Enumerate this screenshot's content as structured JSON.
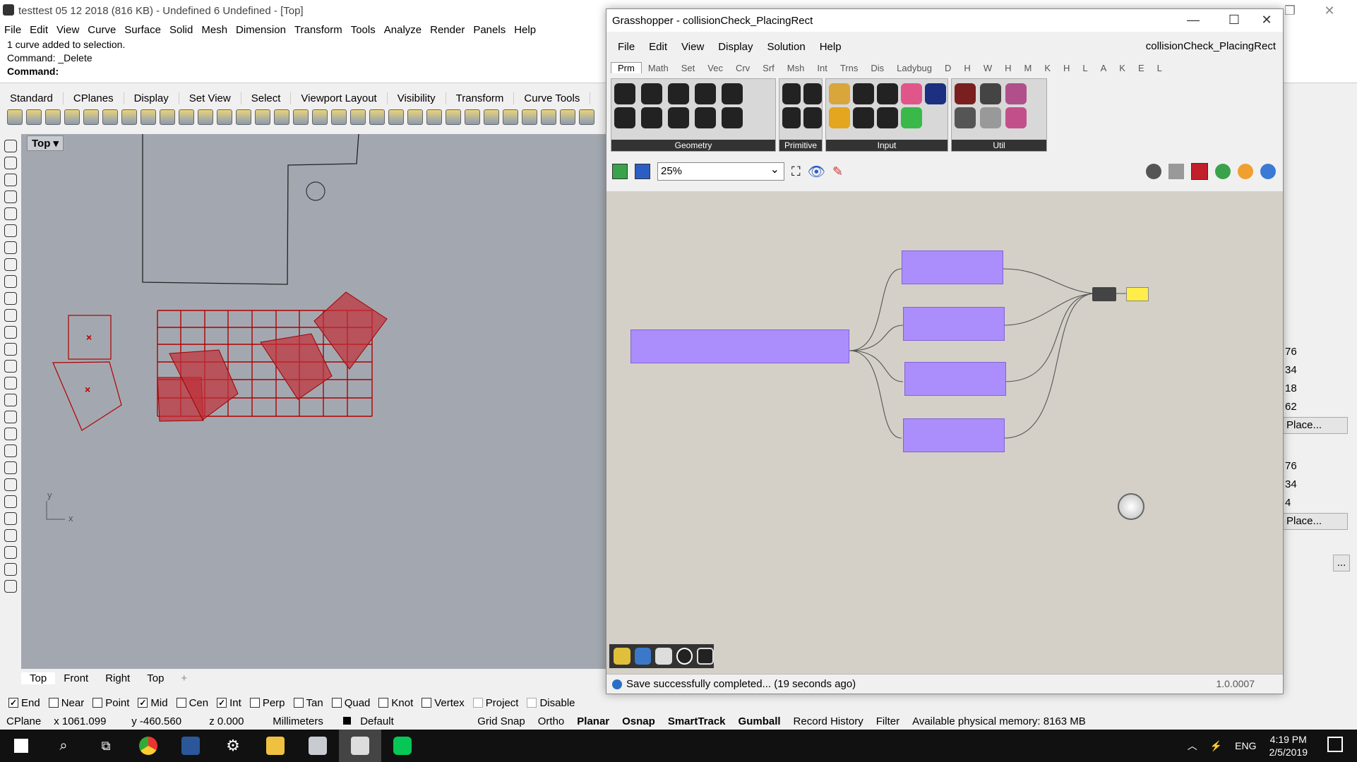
{
  "rhino": {
    "title": "testtest 05 12 2018 (816 KB) - Undefined 6 Undefined - [Top]",
    "menu": [
      "File",
      "Edit",
      "View",
      "Curve",
      "Surface",
      "Solid",
      "Mesh",
      "Dimension",
      "Transform",
      "Tools",
      "Analyze",
      "Render",
      "Panels",
      "Help"
    ],
    "command_history": [
      "1 curve added to selection.",
      "Command: _Delete"
    ],
    "command_prompt": "Command:",
    "toolbar_tabs": [
      "Standard",
      "CPlanes",
      "Display",
      "Set View",
      "Select",
      "Viewport Layout",
      "Visibility",
      "Transform",
      "Curve Tools"
    ],
    "viewport_name": "Top",
    "axis_x": "x",
    "axis_y": "y",
    "viewport_tabs": [
      "Top",
      "Front",
      "Right",
      "Top"
    ],
    "viewport_add": "+",
    "osnaps": [
      {
        "label": "End",
        "checked": true
      },
      {
        "label": "Near",
        "checked": false
      },
      {
        "label": "Point",
        "checked": false
      },
      {
        "label": "Mid",
        "checked": true
      },
      {
        "label": "Cen",
        "checked": false
      },
      {
        "label": "Int",
        "checked": true
      },
      {
        "label": "Perp",
        "checked": false
      },
      {
        "label": "Tan",
        "checked": false
      },
      {
        "label": "Quad",
        "checked": false
      },
      {
        "label": "Knot",
        "checked": false
      },
      {
        "label": "Vertex",
        "checked": false
      },
      {
        "label": "Project",
        "checked": false
      },
      {
        "label": "Disable",
        "checked": false
      }
    ],
    "status": {
      "cplane": "CPlane",
      "x": "x 1061.099",
      "y": "y -460.560",
      "z": "z 0.000",
      "units": "Millimeters",
      "layer": "Default",
      "grid_snap": "Grid Snap",
      "ortho": "Ortho",
      "planar": "Planar",
      "osnap": "Osnap",
      "smarttrack": "SmartTrack",
      "gumball": "Gumball",
      "record_history": "Record History",
      "filter": "Filter",
      "memory": "Available physical memory: 8163 MB"
    },
    "right_panel": {
      "values": [
        "76",
        "34",
        "18",
        "62",
        "76",
        "34",
        "4"
      ],
      "place_button": "Place...",
      "ellipsis": "..."
    }
  },
  "grasshopper": {
    "title": "Grasshopper - collisionCheck_PlacingRect",
    "document_name": "collisionCheck_PlacingRect",
    "menu": [
      "File",
      "Edit",
      "View",
      "Display",
      "Solution",
      "Help"
    ],
    "tabs": [
      "Prm",
      "Math",
      "Set",
      "Vec",
      "Crv",
      "Srf",
      "Msh",
      "Int",
      "Trns",
      "Dis",
      "Ladybug",
      "D",
      "H",
      "W",
      "H",
      "M",
      "K",
      "H",
      "L",
      "A",
      "K",
      "E",
      "L"
    ],
    "groups": [
      "Geometry",
      "Primitive",
      "Input",
      "Util"
    ],
    "zoom": "25%",
    "status": "Save successfully completed... (19 seconds ago)",
    "version": "1.0.0007"
  },
  "taskbar": {
    "lang": "ENG",
    "time": "4:19 PM",
    "date": "2/5/2019"
  },
  "colors": {
    "viewport_bg": "#a3a8b0",
    "gh_canvas": "#d4d0c8",
    "cluster": "#a98bff",
    "accent_red": "#b00000"
  }
}
